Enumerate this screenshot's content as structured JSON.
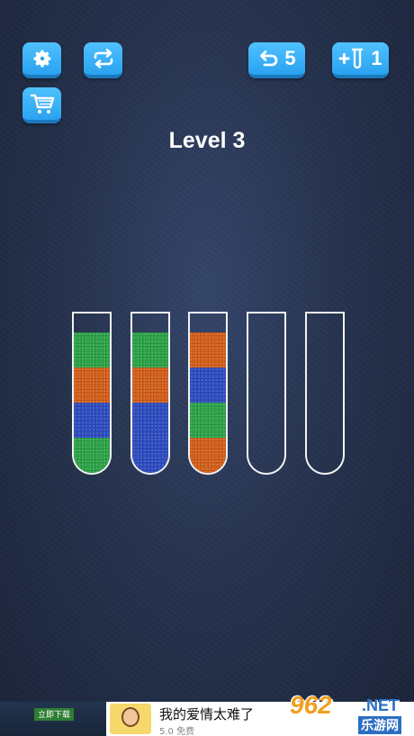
{
  "toolbar": {
    "undo_count": "5",
    "add_tube_count": "1"
  },
  "level_title": "Level 3",
  "colors": {
    "green": "#2ea84a",
    "orange": "#d9621c",
    "blue": "#2f4fc7",
    "button": "#3bb3f8"
  },
  "tubes": [
    {
      "layers_bottom_to_top": [
        "green",
        "blue",
        "orange",
        "green"
      ]
    },
    {
      "layers_bottom_to_top": [
        "blue",
        "blue",
        "orange",
        "green"
      ]
    },
    {
      "layers_bottom_to_top": [
        "orange",
        "green",
        "blue",
        "orange"
      ]
    },
    {
      "layers_bottom_to_top": []
    },
    {
      "layers_bottom_to_top": []
    }
  ],
  "ad": {
    "download_label": "立即下载",
    "title": "我的爱情太难了",
    "rating": "5.0 免费"
  },
  "watermark": {
    "number": "962",
    "suffix": ".NET",
    "site": "乐游网"
  }
}
